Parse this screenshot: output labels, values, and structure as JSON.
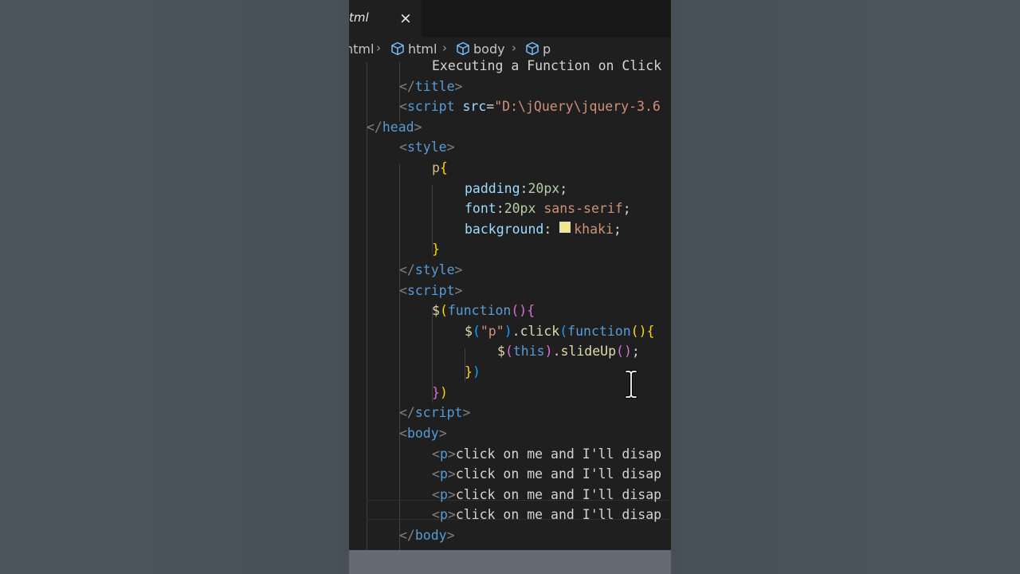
{
  "tab": {
    "label": "tml",
    "close_icon": "×"
  },
  "breadcrumb": {
    "items": [
      "html",
      "html",
      "body",
      "p"
    ],
    "separator": "›"
  },
  "code": {
    "l1_text": "Executing a Function on Click",
    "l2_tag": "title",
    "l3_tag": "script",
    "l3_attr": "src",
    "l3_value": "\"D:\\jQuery\\jquery-3.6",
    "l4_tag": "head",
    "l5_tag": "style",
    "l6_selector": "p",
    "l7_prop": "padding",
    "l7_value": "20px",
    "l8_prop": "font",
    "l8_value_num": "20px",
    "l8_value_str": "sans-serif",
    "l9_prop": "background",
    "l9_value": "khaki",
    "l9_swatch_color": "#f0e68c",
    "l11_tag": "style",
    "l12_tag": "script",
    "l13_fn": "function",
    "l14_sel": "\"p\"",
    "l14_method": "click",
    "l14_fn": "function",
    "l15_this": "this",
    "l15_method": "slideUp",
    "l18_tag": "script",
    "l19_tag": "body",
    "p_tag": "p",
    "p_text": "click on me and I'll disap",
    "l24_tag": "body"
  },
  "colors": {
    "editor_bg": "#1f1f1f",
    "tag": "#569cd6",
    "string": "#ce9178",
    "bracket_gold": "#ffd700"
  }
}
